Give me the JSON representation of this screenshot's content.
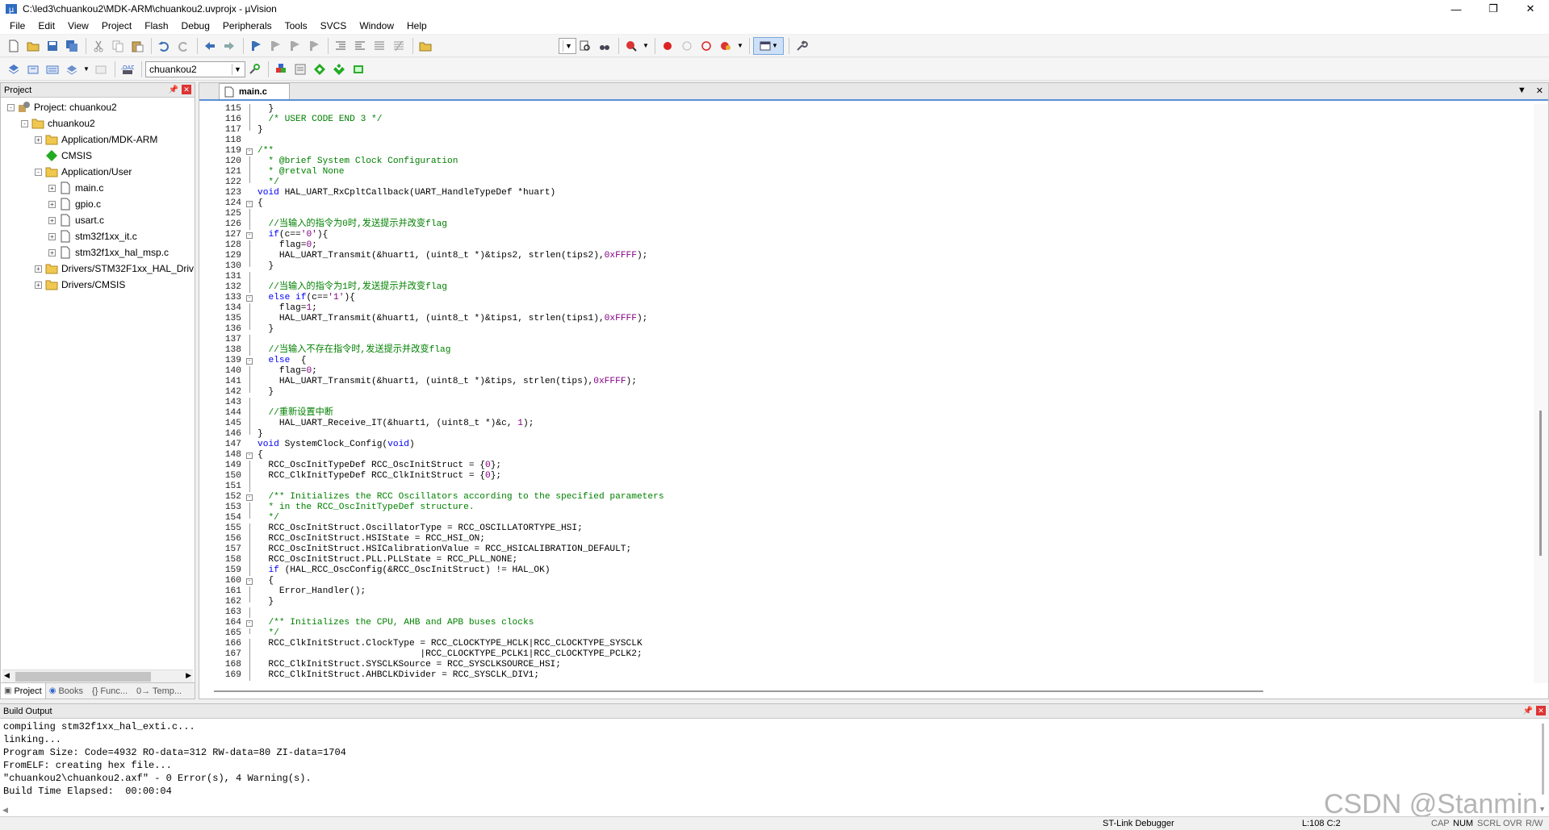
{
  "window": {
    "title": "C:\\led3\\chuankou2\\MDK-ARM\\chuankou2.uvprojx - µVision",
    "minimize": "—",
    "maximize": "❐",
    "close": "✕"
  },
  "menu": [
    "File",
    "Edit",
    "View",
    "Project",
    "Flash",
    "Debug",
    "Peripherals",
    "Tools",
    "SVCS",
    "Window",
    "Help"
  ],
  "toolbar": {
    "target_select": "chuankou2"
  },
  "project_panel": {
    "title": "Project",
    "tree": [
      {
        "label": "Project: chuankou2",
        "level": 0,
        "expander": "-",
        "icon": "project-icon"
      },
      {
        "label": "chuankou2",
        "level": 1,
        "expander": "-",
        "icon": "folder-icon"
      },
      {
        "label": "Application/MDK-ARM",
        "level": 2,
        "expander": "+",
        "icon": "folder-icon"
      },
      {
        "label": "CMSIS",
        "level": 2,
        "expander": "",
        "icon": "diamond-icon"
      },
      {
        "label": "Application/User",
        "level": 2,
        "expander": "-",
        "icon": "folder-icon"
      },
      {
        "label": "main.c",
        "level": 3,
        "expander": "+",
        "icon": "file-icon"
      },
      {
        "label": "gpio.c",
        "level": 3,
        "expander": "+",
        "icon": "file-icon"
      },
      {
        "label": "usart.c",
        "level": 3,
        "expander": "+",
        "icon": "file-icon"
      },
      {
        "label": "stm32f1xx_it.c",
        "level": 3,
        "expander": "+",
        "icon": "file-icon"
      },
      {
        "label": "stm32f1xx_hal_msp.c",
        "level": 3,
        "expander": "+",
        "icon": "file-icon"
      },
      {
        "label": "Drivers/STM32F1xx_HAL_Driv",
        "level": 2,
        "expander": "+",
        "icon": "folder-icon"
      },
      {
        "label": "Drivers/CMSIS",
        "level": 2,
        "expander": "+",
        "icon": "folder-icon"
      }
    ],
    "tabs": [
      {
        "label": "Project",
        "icon": "project-tab-icon"
      },
      {
        "label": "Books",
        "icon": "books-icon"
      },
      {
        "label": "{} Func...",
        "icon": "functions-icon"
      },
      {
        "label": "0→ Temp...",
        "icon": "templates-icon"
      }
    ]
  },
  "editor": {
    "tab": "main.c",
    "lines": [
      {
        "n": "115",
        "f": "l",
        "segs": [
          [
            "  }",
            ""
          ]
        ]
      },
      {
        "n": "116",
        "f": "l",
        "segs": [
          [
            "  ",
            ""
          ],
          [
            "/* USER CODE END 3 */",
            "cm"
          ]
        ]
      },
      {
        "n": "117",
        "f": "e",
        "segs": [
          [
            "}",
            ""
          ]
        ]
      },
      {
        "n": "118",
        "f": "",
        "segs": [
          [
            "",
            ""
          ]
        ]
      },
      {
        "n": "119",
        "f": "-",
        "segs": [
          [
            "/**",
            "cm"
          ]
        ]
      },
      {
        "n": "120",
        "f": "l",
        "segs": [
          [
            "  * @brief System Clock Configuration",
            "cm"
          ]
        ]
      },
      {
        "n": "121",
        "f": "l",
        "segs": [
          [
            "  * @retval None",
            "cm"
          ]
        ]
      },
      {
        "n": "122",
        "f": "e",
        "segs": [
          [
            "  */",
            "cm"
          ]
        ]
      },
      {
        "n": "123",
        "f": "",
        "segs": [
          [
            "void",
            "kw"
          ],
          [
            " HAL_UART_RxCpltCallback(UART_HandleTypeDef *huart)",
            ""
          ]
        ]
      },
      {
        "n": "124",
        "f": "-",
        "segs": [
          [
            "{",
            ""
          ]
        ]
      },
      {
        "n": "125",
        "f": "l",
        "segs": [
          [
            "",
            ""
          ]
        ]
      },
      {
        "n": "126",
        "f": "l",
        "segs": [
          [
            "  ",
            ""
          ],
          [
            "//当输入的指令为0时,发送提示并改变flag",
            "cm"
          ]
        ]
      },
      {
        "n": "127",
        "f": "-",
        "segs": [
          [
            "  ",
            ""
          ],
          [
            "if",
            "kw"
          ],
          [
            "(c==",
            ""
          ],
          [
            "'0'",
            "num"
          ],
          [
            "){",
            ""
          ]
        ]
      },
      {
        "n": "128",
        "f": "l",
        "segs": [
          [
            "    flag=",
            ""
          ],
          [
            "0",
            "num"
          ],
          [
            ";",
            ""
          ]
        ]
      },
      {
        "n": "129",
        "f": "l",
        "segs": [
          [
            "    HAL_UART_Transmit(&huart1, (uint8_t *)&tips2, strlen(tips2),",
            ""
          ],
          [
            "0xFFFF",
            "num"
          ],
          [
            ");",
            ""
          ]
        ]
      },
      {
        "n": "130",
        "f": "e",
        "segs": [
          [
            "  }",
            ""
          ]
        ]
      },
      {
        "n": "131",
        "f": "l",
        "segs": [
          [
            "",
            ""
          ]
        ]
      },
      {
        "n": "132",
        "f": "l",
        "segs": [
          [
            "  ",
            ""
          ],
          [
            "//当输入的指令为1时,发送提示并改变flag",
            "cm"
          ]
        ]
      },
      {
        "n": "133",
        "f": "-",
        "segs": [
          [
            "  ",
            ""
          ],
          [
            "else if",
            "kw"
          ],
          [
            "(c==",
            ""
          ],
          [
            "'1'",
            "num"
          ],
          [
            "){",
            ""
          ]
        ]
      },
      {
        "n": "134",
        "f": "l",
        "segs": [
          [
            "    flag=",
            ""
          ],
          [
            "1",
            "num"
          ],
          [
            ";",
            ""
          ]
        ]
      },
      {
        "n": "135",
        "f": "l",
        "segs": [
          [
            "    HAL_UART_Transmit(&huart1, (uint8_t *)&tips1, strlen(tips1),",
            ""
          ],
          [
            "0xFFFF",
            "num"
          ],
          [
            ");",
            ""
          ]
        ]
      },
      {
        "n": "136",
        "f": "e",
        "segs": [
          [
            "  }",
            ""
          ]
        ]
      },
      {
        "n": "137",
        "f": "l",
        "segs": [
          [
            "",
            ""
          ]
        ]
      },
      {
        "n": "138",
        "f": "l",
        "segs": [
          [
            "  ",
            ""
          ],
          [
            "//当输入不存在指令时,发送提示并改变flag",
            "cm"
          ]
        ]
      },
      {
        "n": "139",
        "f": "-",
        "segs": [
          [
            "  ",
            ""
          ],
          [
            "else",
            "kw"
          ],
          [
            "  {",
            ""
          ]
        ]
      },
      {
        "n": "140",
        "f": "l",
        "segs": [
          [
            "    flag=",
            ""
          ],
          [
            "0",
            "num"
          ],
          [
            ";",
            ""
          ]
        ]
      },
      {
        "n": "141",
        "f": "l",
        "segs": [
          [
            "    HAL_UART_Transmit(&huart1, (uint8_t *)&tips, strlen(tips),",
            ""
          ],
          [
            "0xFFFF",
            "num"
          ],
          [
            ");",
            ""
          ]
        ]
      },
      {
        "n": "142",
        "f": "e",
        "segs": [
          [
            "  }",
            ""
          ]
        ]
      },
      {
        "n": "143",
        "f": "l",
        "segs": [
          [
            "",
            ""
          ]
        ]
      },
      {
        "n": "144",
        "f": "l",
        "segs": [
          [
            "  ",
            ""
          ],
          [
            "//重新设置中断",
            "cm"
          ]
        ]
      },
      {
        "n": "145",
        "f": "l",
        "segs": [
          [
            "    HAL_UART_Receive_IT(&huart1, (uint8_t *)&c, ",
            ""
          ],
          [
            "1",
            "num"
          ],
          [
            ");",
            ""
          ]
        ]
      },
      {
        "n": "146",
        "f": "e",
        "segs": [
          [
            "}",
            ""
          ]
        ]
      },
      {
        "n": "147",
        "f": "",
        "segs": [
          [
            "void",
            "kw"
          ],
          [
            " SystemClock_Config(",
            ""
          ],
          [
            "void",
            "kw"
          ],
          [
            ")",
            ""
          ]
        ]
      },
      {
        "n": "148",
        "f": "-",
        "segs": [
          [
            "{",
            ""
          ]
        ]
      },
      {
        "n": "149",
        "f": "l",
        "segs": [
          [
            "  RCC_OscInitTypeDef RCC_OscInitStruct = {",
            ""
          ],
          [
            "0",
            "num"
          ],
          [
            "};",
            ""
          ]
        ]
      },
      {
        "n": "150",
        "f": "l",
        "segs": [
          [
            "  RCC_ClkInitTypeDef RCC_ClkInitStruct = {",
            ""
          ],
          [
            "0",
            "num"
          ],
          [
            "};",
            ""
          ]
        ]
      },
      {
        "n": "151",
        "f": "l",
        "segs": [
          [
            "",
            ""
          ]
        ]
      },
      {
        "n": "152",
        "f": "-",
        "segs": [
          [
            "  ",
            ""
          ],
          [
            "/** Initializes the RCC Oscillators according to the specified parameters",
            "cm"
          ]
        ]
      },
      {
        "n": "153",
        "f": "l",
        "segs": [
          [
            "  ",
            ""
          ],
          [
            "* in the RCC_OscInitTypeDef structure.",
            "cm"
          ]
        ]
      },
      {
        "n": "154",
        "f": "e",
        "segs": [
          [
            "  ",
            ""
          ],
          [
            "*/",
            "cm"
          ]
        ]
      },
      {
        "n": "155",
        "f": "l",
        "segs": [
          [
            "  RCC_OscInitStruct.OscillatorType = RCC_OSCILLATORTYPE_HSI;",
            ""
          ]
        ]
      },
      {
        "n": "156",
        "f": "l",
        "segs": [
          [
            "  RCC_OscInitStruct.HSIState = RCC_HSI_ON;",
            ""
          ]
        ]
      },
      {
        "n": "157",
        "f": "l",
        "segs": [
          [
            "  RCC_OscInitStruct.HSICalibrationValue = RCC_HSICALIBRATION_DEFAULT;",
            ""
          ]
        ]
      },
      {
        "n": "158",
        "f": "l",
        "segs": [
          [
            "  RCC_OscInitStruct.PLL.PLLState = RCC_PLL_NONE;",
            ""
          ]
        ]
      },
      {
        "n": "159",
        "f": "l",
        "segs": [
          [
            "  ",
            ""
          ],
          [
            "if",
            "kw"
          ],
          [
            " (HAL_RCC_OscConfig(&RCC_OscInitStruct) != HAL_OK)",
            ""
          ]
        ]
      },
      {
        "n": "160",
        "f": "-",
        "segs": [
          [
            "  {",
            ""
          ]
        ]
      },
      {
        "n": "161",
        "f": "l",
        "segs": [
          [
            "    Error_Handler();",
            ""
          ]
        ]
      },
      {
        "n": "162",
        "f": "e",
        "segs": [
          [
            "  }",
            ""
          ]
        ]
      },
      {
        "n": "163",
        "f": "l",
        "segs": [
          [
            "",
            ""
          ]
        ]
      },
      {
        "n": "164",
        "f": "-",
        "segs": [
          [
            "  ",
            ""
          ],
          [
            "/** Initializes the CPU, AHB and APB buses clocks",
            "cm"
          ]
        ]
      },
      {
        "n": "165",
        "f": "e",
        "segs": [
          [
            "  ",
            ""
          ],
          [
            "*/",
            "cm"
          ]
        ]
      },
      {
        "n": "166",
        "f": "l",
        "segs": [
          [
            "  RCC_ClkInitStruct.ClockType = RCC_CLOCKTYPE_HCLK|RCC_CLOCKTYPE_SYSCLK",
            ""
          ]
        ]
      },
      {
        "n": "167",
        "f": "l",
        "segs": [
          [
            "                              |RCC_CLOCKTYPE_PCLK1|RCC_CLOCKTYPE_PCLK2;",
            ""
          ]
        ]
      },
      {
        "n": "168",
        "f": "l",
        "segs": [
          [
            "  RCC_ClkInitStruct.SYSCLKSource = RCC_SYSCLKSOURCE_HSI;",
            ""
          ]
        ]
      },
      {
        "n": "169",
        "f": "l",
        "segs": [
          [
            "  RCC_ClkInitStruct.AHBCLKDivider = RCC_SYSCLK_DIV1;",
            ""
          ]
        ]
      }
    ]
  },
  "build_output": {
    "title": "Build Output",
    "text": "compiling stm32f1xx_hal_exti.c...\nlinking...\nProgram Size: Code=4932 RO-data=312 RW-data=80 ZI-data=1704\nFromELF: creating hex file...\n\"chuankou2\\chuankou2.axf\" - 0 Error(s), 4 Warning(s).\nBuild Time Elapsed:  00:00:04"
  },
  "status": {
    "debugger": "ST-Link Debugger",
    "position": "L:108 C:2",
    "cap": "CAP",
    "num": "NUM",
    "scrl": "SCRL",
    "ovr": "OVR",
    "rw": "R/W"
  },
  "watermark": "CSDN @Stanmin"
}
